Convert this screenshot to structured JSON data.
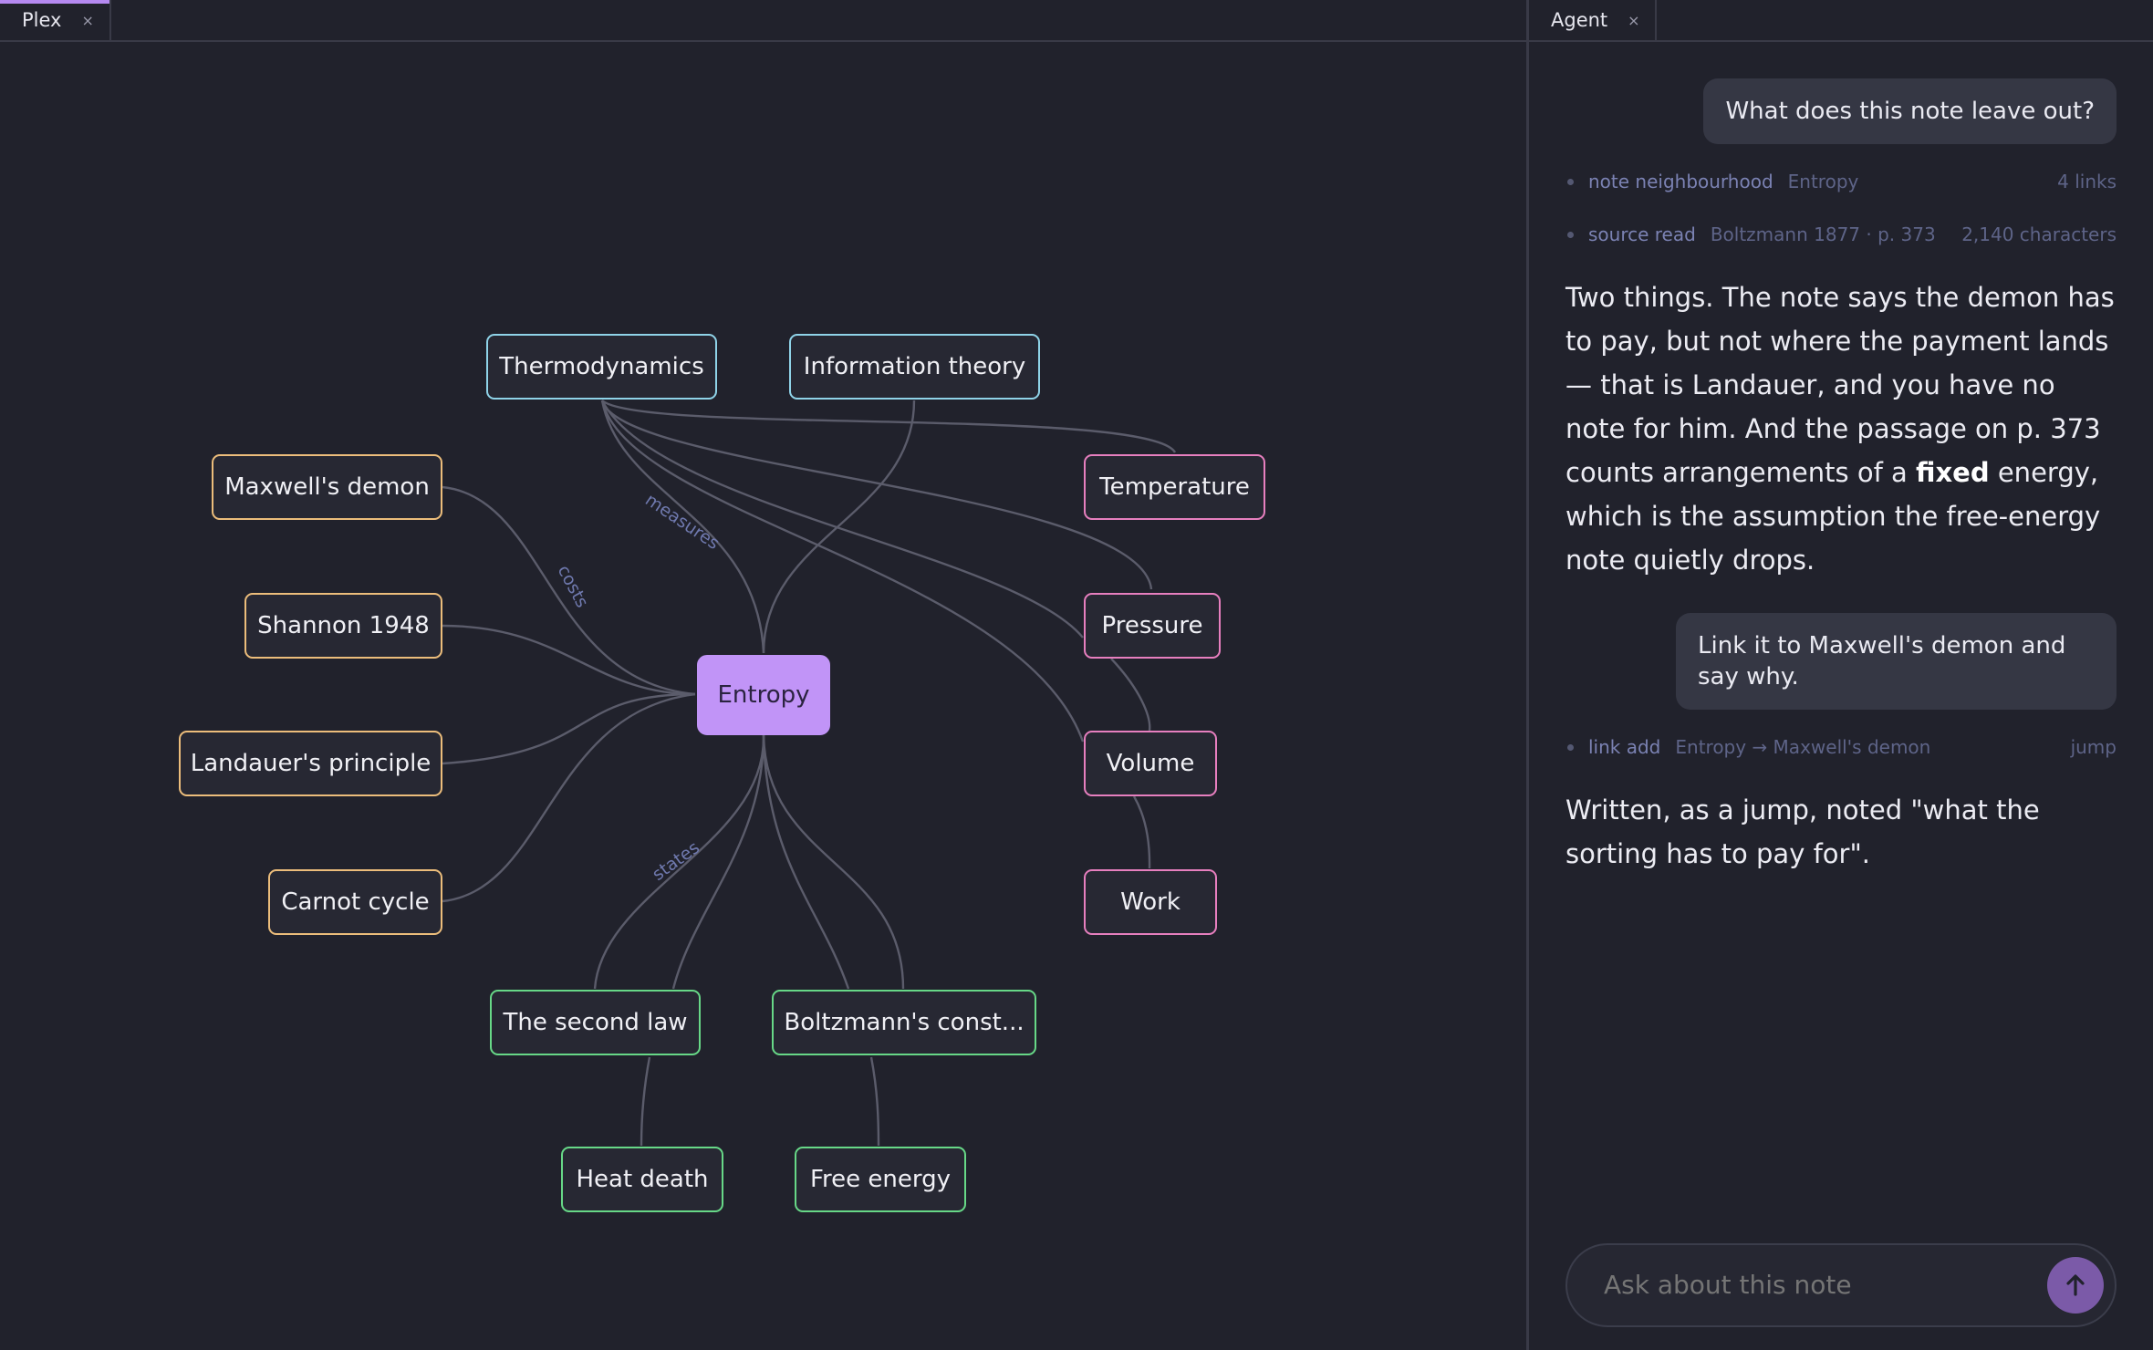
{
  "left_tab": {
    "title": "Plex",
    "close": "×"
  },
  "right_tab": {
    "title": "Agent",
    "close": "×"
  },
  "graph": {
    "center": "Entropy",
    "nodes": {
      "thermodynamics": "Thermodynamics",
      "information_theory": "Information theory",
      "maxwells_demon": "Maxwell's demon",
      "shannon_1948": "Shannon 1948",
      "landauers_principle": "Landauer's principle",
      "carnot_cycle": "Carnot cycle",
      "temperature": "Temperature",
      "pressure": "Pressure",
      "volume": "Volume",
      "work": "Work",
      "second_law": "The second law",
      "boltzmanns_const": "Boltzmann's const...",
      "heat_death": "Heat death",
      "free_energy": "Free energy"
    },
    "edge_labels": {
      "measures": "measures",
      "costs": "costs",
      "states": "states"
    },
    "colors": {
      "blue": "#8fd3e8",
      "orange": "#ecbd7b",
      "pink": "#e77fbf",
      "green": "#67d887",
      "center": "#c194f7"
    }
  },
  "chat": {
    "user_msg_1": "What does this note leave out?",
    "tool_1": {
      "name": "note neighbourhood",
      "arg": "Entropy",
      "meta": "4 links"
    },
    "tool_2": {
      "name": "source read",
      "arg": "Boltzmann 1877 · p. 373",
      "meta": "2,140 characters"
    },
    "answer_1_a": "Two things. The note says the demon has to pay, but not where the payment lands — that is Landauer, and you have no note for him. And the passage on p. 373 counts arrangements of a ",
    "answer_1_bold": "fixed",
    "answer_1_b": " energy, which is the assumption the free-energy note quietly drops.",
    "user_msg_2": "Link it to Maxwell's demon and say why.",
    "tool_3": {
      "name": "link add",
      "arg": "Entropy → Maxwell's demon",
      "meta": "jump"
    },
    "answer_2": "Written, as a jump, noted \"what the sorting has to pay for\".",
    "composer_placeholder": "Ask about this note",
    "send_icon": "arrow-up-icon"
  }
}
